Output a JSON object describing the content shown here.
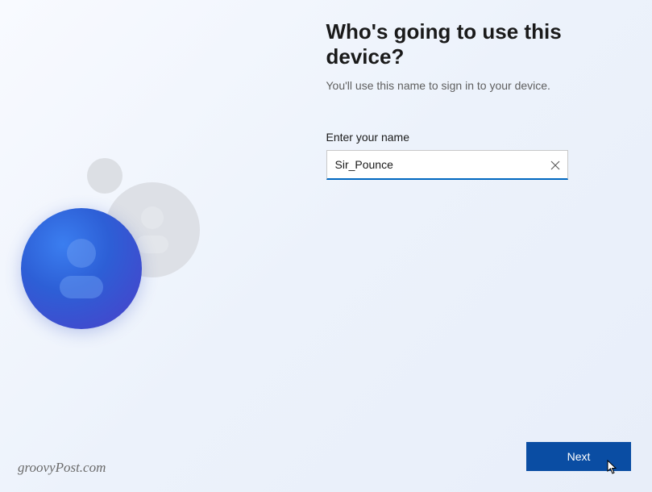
{
  "heading": "Who's going to use this device?",
  "subheading": "You'll use this name to sign in to your device.",
  "input": {
    "label": "Enter your name",
    "value": "Sir_Pounce"
  },
  "button": {
    "next": "Next"
  },
  "watermark": "groovyPost.com"
}
